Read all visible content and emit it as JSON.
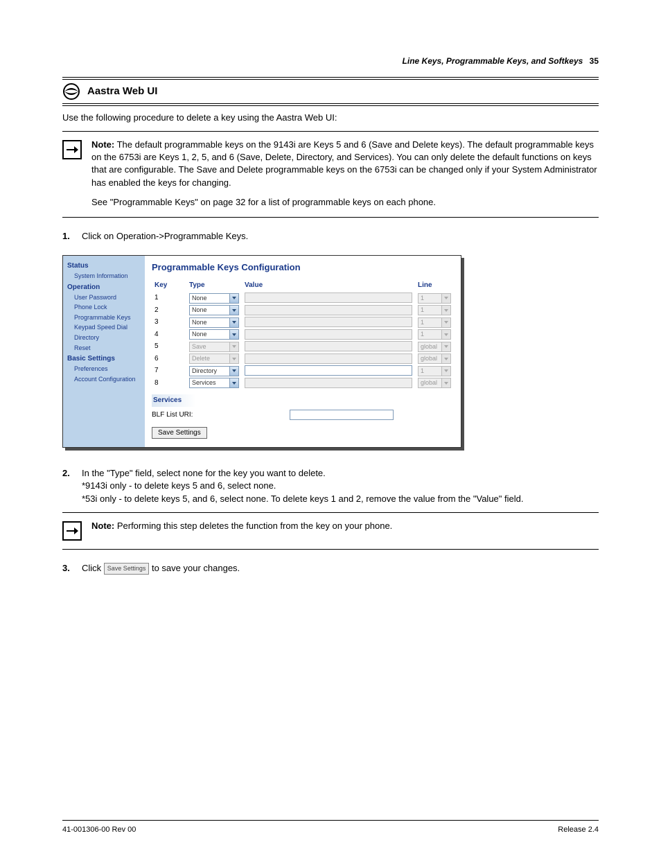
{
  "header": {
    "title": "Line Keys, Programmable Keys, and Softkeys",
    "page_number": "35"
  },
  "section": {
    "label": "Aastra Web UI"
  },
  "intro": "Use the following procedure to delete a key using the Aastra Web UI:",
  "note1": {
    "lead": "Note:",
    "body": "The default programmable keys on the 9143i are Keys 5 and 6 (Save and Delete keys). The default programmable keys on the 6753i are Keys 1, 2, 5, and 6 (Save, Delete, Directory, and Services). You can only delete the default functions on keys that are configurable. The Save and Delete programmable keys on the 6753i can be changed only if your System Administrator has enabled the keys for changing.",
    "ref": "See \"Programmable Keys\" on page 32 for a list of programmable keys on each phone."
  },
  "steps": {
    "s1": "Click on Operation->Programmable Keys.",
    "s2a": "In the \"Type\" field, select none for the key you want to delete.",
    "s2b": "*9143i only - to delete keys 5 and 6, select none.",
    "s2c": "*53i only - to delete keys 5, and 6, select none. To delete keys 1 and 2, remove the value from the \"Value\" field."
  },
  "note2": {
    "lead": "Note:",
    "body": "Performing this step deletes the function from the key on your phone."
  },
  "s3a": "Click",
  "s3b": "to save your changes.",
  "inline_button": "Save Settings",
  "ui": {
    "title": "Programmable Keys Configuration",
    "sidebar": {
      "status": "Status",
      "items_status": [
        "System Information"
      ],
      "operation": "Operation",
      "items_operation": [
        "User Password",
        "Phone Lock",
        "Programmable Keys",
        "Keypad Speed Dial",
        "Directory",
        "Reset"
      ],
      "basic": "Basic Settings",
      "items_basic": [
        "Preferences",
        "Account Configuration"
      ]
    },
    "cols": {
      "key": "Key",
      "type": "Type",
      "value": "Value",
      "line": "Line"
    },
    "rows": [
      {
        "key": "1",
        "type": "None",
        "type_enabled": true,
        "value": "",
        "value_enabled": false,
        "line": "1",
        "line_enabled": false
      },
      {
        "key": "2",
        "type": "None",
        "type_enabled": true,
        "value": "",
        "value_enabled": false,
        "line": "1",
        "line_enabled": false
      },
      {
        "key": "3",
        "type": "None",
        "type_enabled": true,
        "value": "",
        "value_enabled": false,
        "line": "1",
        "line_enabled": false
      },
      {
        "key": "4",
        "type": "None",
        "type_enabled": true,
        "value": "",
        "value_enabled": false,
        "line": "1",
        "line_enabled": false
      },
      {
        "key": "5",
        "type": "Save",
        "type_enabled": false,
        "value": "",
        "value_enabled": false,
        "line": "global",
        "line_enabled": false
      },
      {
        "key": "6",
        "type": "Delete",
        "type_enabled": false,
        "value": "",
        "value_enabled": false,
        "line": "global",
        "line_enabled": false
      },
      {
        "key": "7",
        "type": "Directory",
        "type_enabled": true,
        "value": "",
        "value_enabled": true,
        "line": "1",
        "line_enabled": false
      },
      {
        "key": "8",
        "type": "Services",
        "type_enabled": true,
        "value": "",
        "value_enabled": false,
        "line": "global",
        "line_enabled": false
      }
    ],
    "services": "Services",
    "blf_label": "BLF List URI:",
    "blf_value": "",
    "save": "Save Settings"
  },
  "footer": {
    "left": "41-001306-00 Rev 00",
    "right": "Release 2.4"
  }
}
